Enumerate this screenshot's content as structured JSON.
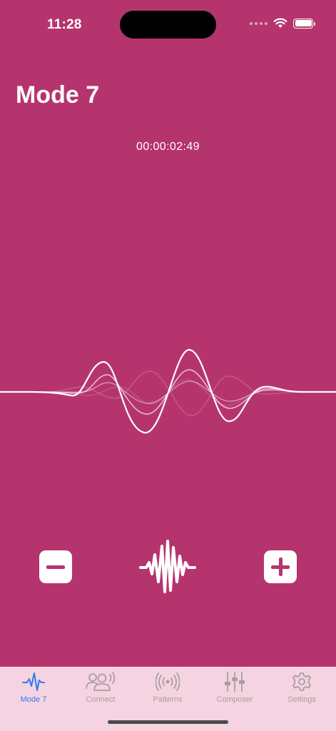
{
  "status_bar": {
    "time": "11:28",
    "wifi_icon": "wifi-icon",
    "battery_icon": "battery-full-icon"
  },
  "header": {
    "title": "Mode 7"
  },
  "player": {
    "elapsed": "00:00:02:49",
    "waveform_icon": "waveform-visualization"
  },
  "controls": {
    "decrease_icon": "minus-icon",
    "pulse_icon": "waveform-pulse-icon",
    "increase_icon": "plus-icon"
  },
  "tab_bar": {
    "active_index": 0,
    "tabs": [
      {
        "label": "Mode 7",
        "icon": "waveform-icon"
      },
      {
        "label": "Connect",
        "icon": "people-broadcast-icon"
      },
      {
        "label": "Patterns",
        "icon": "broadcast-icon"
      },
      {
        "label": "Composer",
        "icon": "sliders-icon"
      },
      {
        "label": "Settings",
        "icon": "gear-icon"
      }
    ]
  },
  "colors": {
    "background": "#b6346d",
    "tab_bar_background": "#f5d3e0",
    "accent_active": "#2f7bf6",
    "tab_inactive": "#a89ea3"
  }
}
